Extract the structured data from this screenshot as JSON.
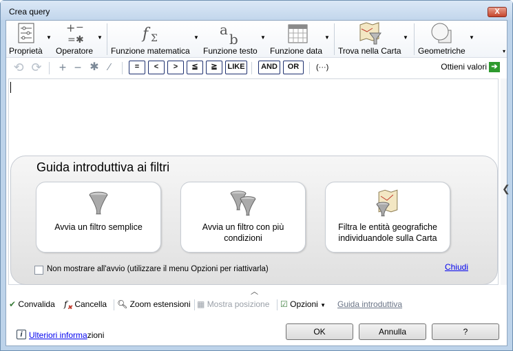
{
  "window": {
    "title": "Crea query",
    "close_label": "X"
  },
  "ribbon": {
    "items": [
      {
        "label": "Proprietà",
        "icon": "properties-icon"
      },
      {
        "label": "Operatore",
        "icon": "operator-icon"
      },
      {
        "label": "Funzione matematica",
        "icon": "math-function-icon"
      },
      {
        "label": "Funzione testo",
        "icon": "text-function-icon"
      },
      {
        "label": "Funzione data",
        "icon": "date-function-icon"
      },
      {
        "label": "Trova nella Carta",
        "icon": "find-in-map-icon"
      },
      {
        "label": "Geometriche",
        "icon": "geometry-icon"
      }
    ]
  },
  "operators": {
    "eq": "=",
    "lt": "<",
    "gt": ">",
    "le": "≦",
    "ge": "≧",
    "like": "LIKE",
    "and": "AND",
    "or": "OR",
    "paren": "(···)"
  },
  "toolbar": {
    "get_values_label": "Ottieni valori"
  },
  "guide": {
    "title": "Guida introduttiva ai filtri",
    "cards": [
      {
        "label": "Avvia un filtro semplice",
        "icon": "funnel-icon"
      },
      {
        "label": "Avvia un filtro con più condizioni",
        "icon": "double-funnel-icon"
      },
      {
        "label": "Filtra le entità geografiche individuandole sulla Carta",
        "icon": "map-funnel-icon"
      }
    ],
    "dont_show_label": "Non mostrare all'avvio (utilizzare il menu Opzioni per riattivarla)",
    "close_label": "Chiudi"
  },
  "bottom_toolbar": {
    "validate": "Convalida",
    "clear": "Cancella",
    "zoom_extents": "Zoom estensioni",
    "show_position": "Mostra posizione",
    "options": "Opzioni",
    "guide": "Guida introduttiva"
  },
  "footer": {
    "more_info_link": "Ulteriori informa",
    "more_info_rest": "zioni",
    "ok": "OK",
    "cancel": "Annulla",
    "help": "?"
  }
}
